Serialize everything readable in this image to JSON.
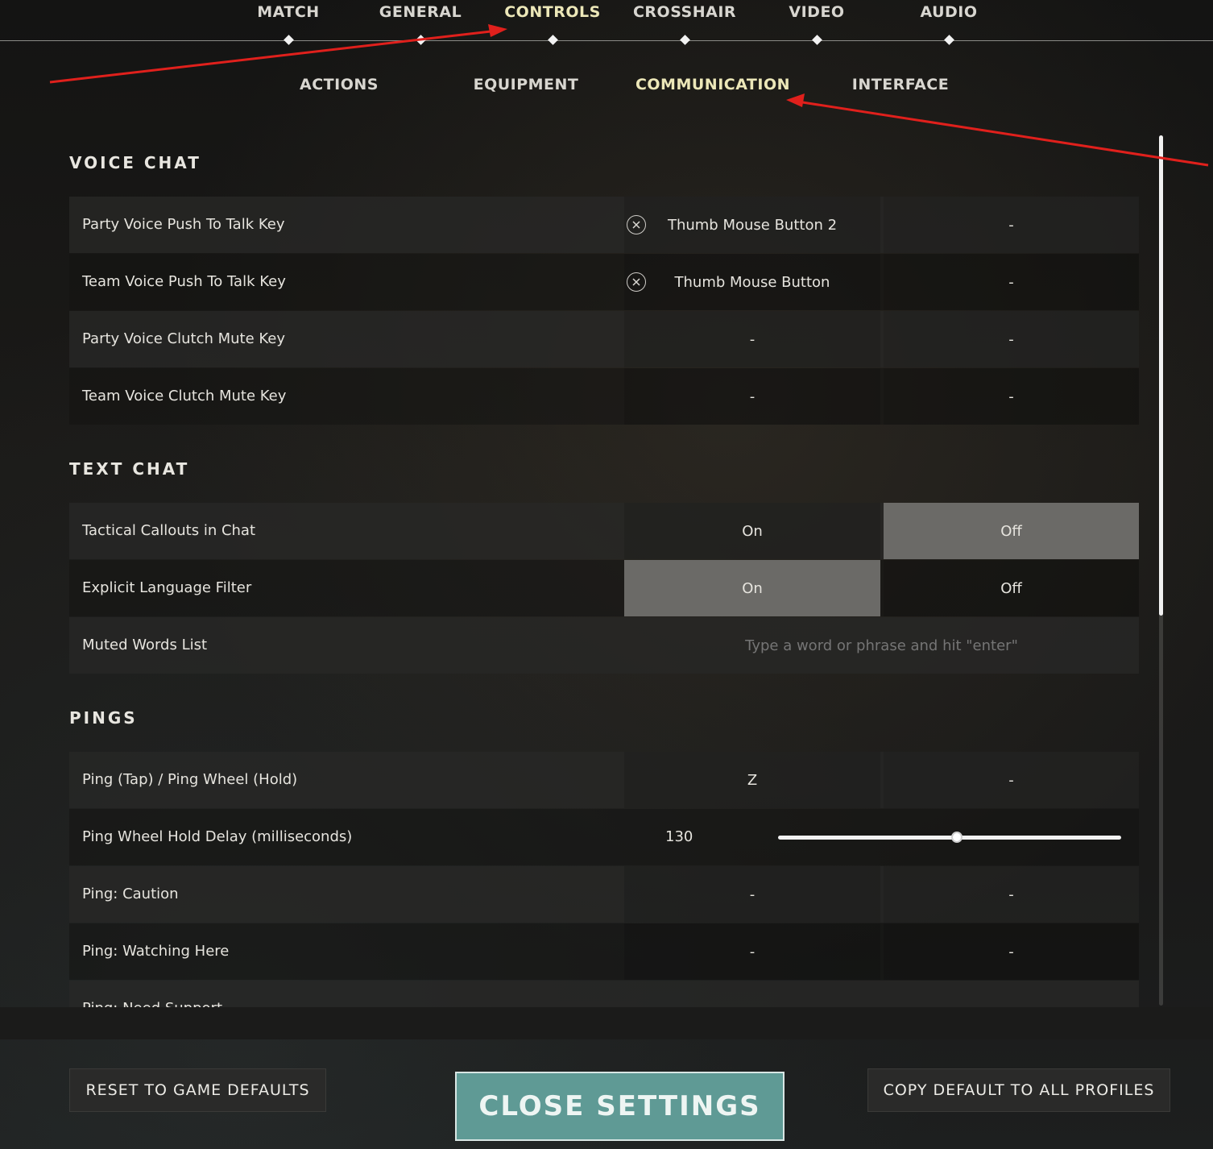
{
  "top_tabs": [
    {
      "label": "MATCH"
    },
    {
      "label": "GENERAL"
    },
    {
      "label": "CONTROLS"
    },
    {
      "label": "CROSSHAIR"
    },
    {
      "label": "VIDEO"
    },
    {
      "label": "AUDIO"
    }
  ],
  "active_top_tab": "CONTROLS",
  "sub_tabs": [
    {
      "label": "ACTIONS"
    },
    {
      "label": "EQUIPMENT"
    },
    {
      "label": "COMMUNICATION"
    },
    {
      "label": "INTERFACE"
    }
  ],
  "active_sub_tab": "COMMUNICATION",
  "voice_chat": {
    "title": "VOICE CHAT",
    "rows": [
      {
        "label": "Party Voice Push To Talk Key",
        "primary": "Thumb Mouse Button 2",
        "secondary": "-"
      },
      {
        "label": "Team Voice Push To Talk Key",
        "primary": "Thumb Mouse Button",
        "secondary": "-"
      },
      {
        "label": "Party Voice Clutch Mute Key",
        "primary": "-",
        "secondary": "-"
      },
      {
        "label": "Team Voice Clutch Mute Key",
        "primary": "-",
        "secondary": "-"
      }
    ]
  },
  "text_chat": {
    "title": "TEXT CHAT",
    "tactical_callouts": {
      "label": "Tactical Callouts in Chat",
      "on": "On",
      "off": "Off",
      "selected": "Off"
    },
    "explicit_filter": {
      "label": "Explicit Language Filter",
      "on": "On",
      "off": "Off",
      "selected": "On"
    },
    "muted_words": {
      "label": "Muted Words List",
      "placeholder": "Type a word or phrase and hit \"enter\""
    }
  },
  "pings": {
    "title": "PINGS",
    "ping_key": {
      "label": "Ping (Tap) / Ping Wheel (Hold)",
      "primary": "Z",
      "secondary": "-"
    },
    "hold_delay": {
      "label": "Ping Wheel Hold Delay (milliseconds)",
      "value": "130",
      "fraction": 0.52
    },
    "caution": {
      "label": "Ping: Caution",
      "primary": "-",
      "secondary": "-"
    },
    "watching": {
      "label": "Ping: Watching Here",
      "primary": "-",
      "secondary": "-"
    },
    "need_support": {
      "label": "Ping: Need Support"
    }
  },
  "footer": {
    "reset_label": "RESET TO GAME DEFAULTS",
    "close_label": "CLOSE SETTINGS",
    "copy_label": "COPY DEFAULT TO ALL PROFILES"
  },
  "colors": {
    "active_tab": "#ece7b8",
    "close_button": "#5f9a95",
    "annotation_arrow": "#e0201c"
  }
}
